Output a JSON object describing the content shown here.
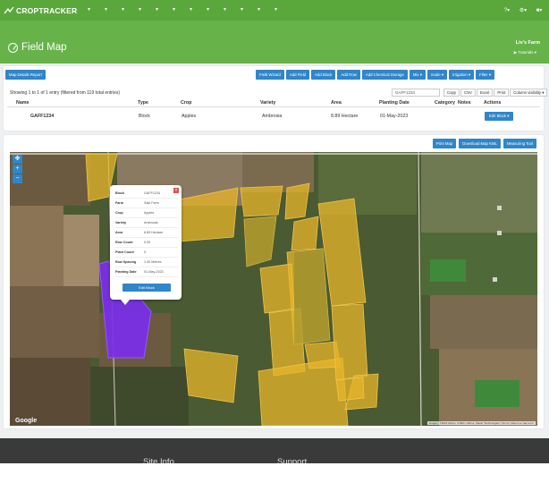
{
  "app": {
    "logo_text": "CROPTRACKER"
  },
  "nav": {
    "items": [
      "▾",
      "▾",
      "▾",
      "▾",
      "▾",
      "▾",
      "▾",
      "▾",
      "▾",
      "▾",
      "▾",
      "▾"
    ],
    "right": [
      "?▾",
      "⚙▾",
      "■▾"
    ]
  },
  "header": {
    "title": "Field Map",
    "farm": "Liv's Farm",
    "tutorials": "▶ Tutorials ▾"
  },
  "toolbar": {
    "report": "Map Details Report",
    "buttons": [
      "Field Wizard",
      "Add Field",
      "Add Block",
      "Add Row",
      "Add Chemical Storage",
      "Mix ▾",
      "Scale ▾",
      "Irrigation ▾",
      "Filter ▾"
    ]
  },
  "table": {
    "showing": "Showing 1 to 1 of 1 entry (filtered from 119 total entries)",
    "search_value": "GAFF1234",
    "export_buttons": [
      "Copy",
      "CSV",
      "Excel",
      "Print",
      "Column visibility ▾"
    ],
    "columns": [
      "Name",
      "Type",
      "Crop",
      "Variety",
      "Area",
      "Planting Date",
      "Category",
      "Notes",
      "Actions"
    ],
    "rows": [
      {
        "name": "GAFF1234",
        "type": "Block",
        "crop": "Apples",
        "variety": "Ambrosia",
        "area": "8.89 Hectare",
        "planting_date": "01-May-2023",
        "edit": "Edit Block ▾"
      }
    ]
  },
  "map": {
    "buttons": [
      "Print Map",
      "Download Map KML",
      "Measuring Tool"
    ],
    "google": "Google",
    "attribution": "Imagery ©2023 Airbus, CNES / Airbus, Maxar Technologies | Terms | Report a map error",
    "popup": {
      "rows": [
        {
          "k": "Block",
          "v": "GAFF1234"
        },
        {
          "k": "Farm",
          "v": "Saki Farm"
        },
        {
          "k": "Crop",
          "v": "Apples"
        },
        {
          "k": "Variety",
          "v": "Ambrosia"
        },
        {
          "k": "Area",
          "v": "8.89 Hectare"
        },
        {
          "k": "Row Count",
          "v": "0.00"
        },
        {
          "k": "Plant Count",
          "v": "0"
        },
        {
          "k": "Row Spacing",
          "v": "1.30 Metres"
        },
        {
          "k": "Planting Date",
          "v": "01-May-2023"
        }
      ],
      "edit": "Edit Block"
    },
    "colors": {
      "highlight": "#7b2cf0",
      "field": "#e8b62a"
    }
  },
  "footer": {
    "left": "Site Info",
    "right": "Support"
  }
}
